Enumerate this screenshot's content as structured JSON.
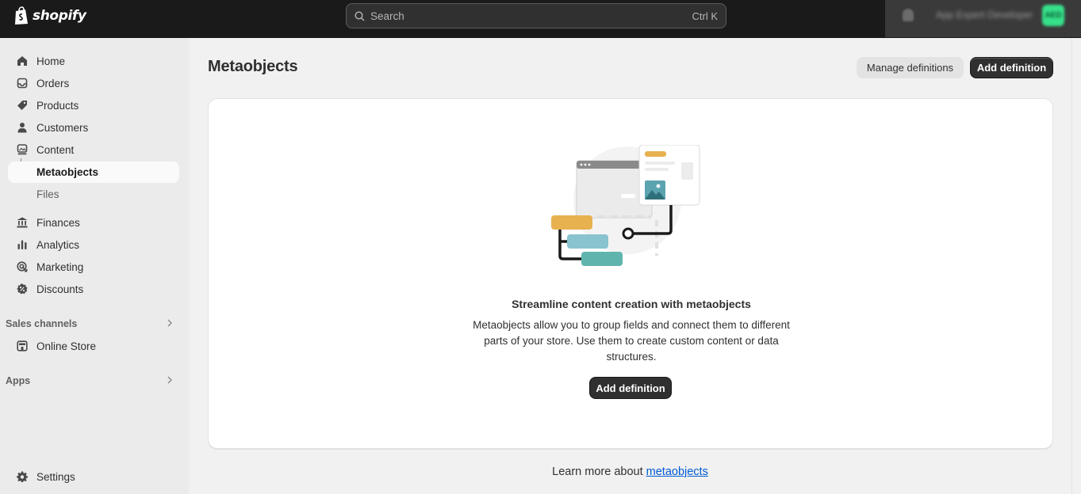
{
  "brand": {
    "name": "shopify"
  },
  "search": {
    "placeholder": "Search",
    "shortcut": "Ctrl K"
  },
  "account": {
    "name": "App Expert Developer",
    "initials": "AED",
    "avatar_color": "#36e08a"
  },
  "sidebar": {
    "items": [
      {
        "label": "Home",
        "icon": "home-icon"
      },
      {
        "label": "Orders",
        "icon": "inbox-icon"
      },
      {
        "label": "Products",
        "icon": "tag-icon"
      },
      {
        "label": "Customers",
        "icon": "person-icon"
      },
      {
        "label": "Content",
        "icon": "content-icon"
      },
      {
        "label": "Metaobjects",
        "active": true
      },
      {
        "label": "Files"
      },
      {
        "label": "Finances",
        "icon": "bank-icon"
      },
      {
        "label": "Analytics",
        "icon": "bar-chart-icon"
      },
      {
        "label": "Marketing",
        "icon": "target-icon"
      },
      {
        "label": "Discounts",
        "icon": "discount-icon"
      }
    ],
    "sales_channels_label": "Sales channels",
    "online_store_label": "Online Store",
    "apps_label": "Apps",
    "settings_label": "Settings"
  },
  "page": {
    "title": "Metaobjects",
    "manage_label": "Manage definitions",
    "add_label": "Add definition"
  },
  "empty_state": {
    "title": "Streamline content creation with metaobjects",
    "description": "Metaobjects allow you to group fields and connect them to different parts of your store. Use them to create custom content or data structures.",
    "button_label": "Add definition"
  },
  "footer": {
    "learn_prefix": "Learn more about",
    "learn_link": "metaobjects"
  },
  "colors": {
    "topbar": "#1a1a1a",
    "primary_button": "#303030",
    "link": "#005bd3",
    "sidebar_bg": "#ebebeb",
    "page_bg": "#f1f1f1"
  }
}
